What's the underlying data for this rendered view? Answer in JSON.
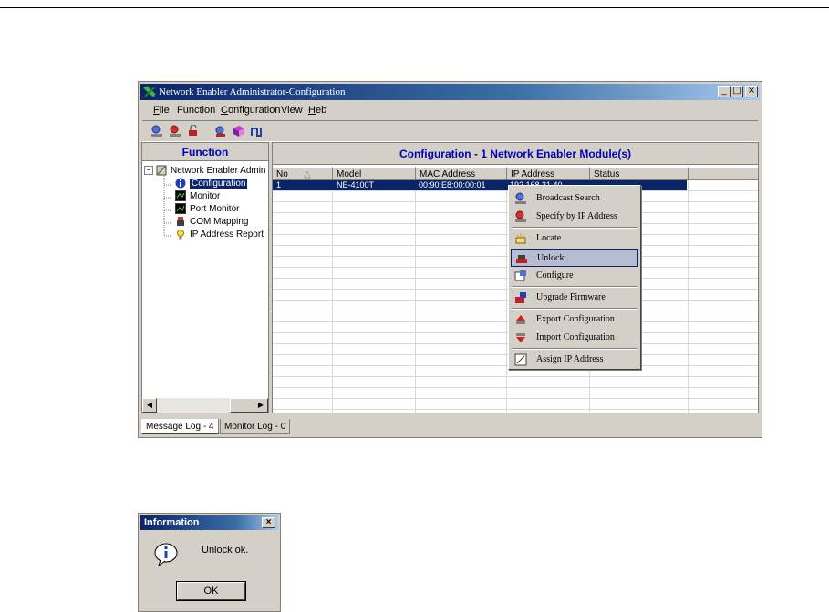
{
  "window": {
    "title": "Network Enabler Administrator-Configuration",
    "controls": [
      "minimize",
      "maximize",
      "close"
    ]
  },
  "menubar": {
    "items": [
      {
        "label": "File",
        "mnemonic": "F"
      },
      {
        "label": "Function",
        "mnemonic": ""
      },
      {
        "label": "Configuration",
        "mnemonic": "C"
      },
      {
        "label": "View",
        "mnemonic": ""
      },
      {
        "label": "Heb",
        "mnemonic": "H"
      }
    ]
  },
  "toolbar": {
    "icons": [
      "broadcast-search-icon",
      "specify-ip-icon",
      "unlock-icon",
      "locate-icon",
      "configure-icon",
      "port-icon"
    ]
  },
  "function_pane": {
    "header": "Function",
    "tree": [
      {
        "label": "Network Enabler Admin",
        "level": 0,
        "icon": "root-icon"
      },
      {
        "label": "Configuration",
        "level": 1,
        "icon": "info-icon",
        "selected": true
      },
      {
        "label": "Monitor",
        "level": 1,
        "icon": "monitor-icon"
      },
      {
        "label": "Port Monitor",
        "level": 1,
        "icon": "port-monitor-icon"
      },
      {
        "label": "COM Mapping",
        "level": 1,
        "icon": "com-mapping-icon"
      },
      {
        "label": "IP Address Report",
        "level": 1,
        "icon": "ip-report-icon"
      }
    ]
  },
  "config_pane": {
    "header": "Configuration - 1 Network Enabler Module(s)",
    "columns": [
      "No",
      "Model",
      "MAC Address",
      "IP Address",
      "Status"
    ],
    "rows": [
      {
        "no": "1",
        "model": "NE-4100T",
        "mac": "00:90:E8:00:00:01",
        "ip": "192.168.31.40",
        "status": ""
      }
    ]
  },
  "context_menu": {
    "items": [
      {
        "label": "Broadcast Search",
        "icon": "broadcast-search-icon"
      },
      {
        "label": "Specify by IP Address",
        "icon": "specify-ip-icon"
      },
      {
        "label": "Locate",
        "icon": "locate-icon"
      },
      {
        "label": "Unlock",
        "icon": "unlock-icon",
        "highlighted": true
      },
      {
        "label": "Configure",
        "icon": "configure-icon"
      },
      {
        "label": "Upgrade Firmware",
        "icon": "upgrade-firmware-icon"
      },
      {
        "label": "Export Configuration",
        "icon": "export-icon"
      },
      {
        "label": "Import Configuration",
        "icon": "import-icon"
      },
      {
        "label": "Assign IP Address",
        "icon": "assign-ip-icon"
      }
    ]
  },
  "status_tabs": [
    {
      "label": "Message Log - 4",
      "active": true
    },
    {
      "label": "Monitor Log - 0",
      "active": false
    }
  ],
  "dialog": {
    "title": "Information",
    "message": "Unlock ok.",
    "ok_label": "OK",
    "icon": "info-icon"
  },
  "colors": {
    "titlebar": "#0a246a",
    "chrome": "#d4d0c8",
    "header_text": "#0000c0",
    "selection": "#0a246a"
  }
}
